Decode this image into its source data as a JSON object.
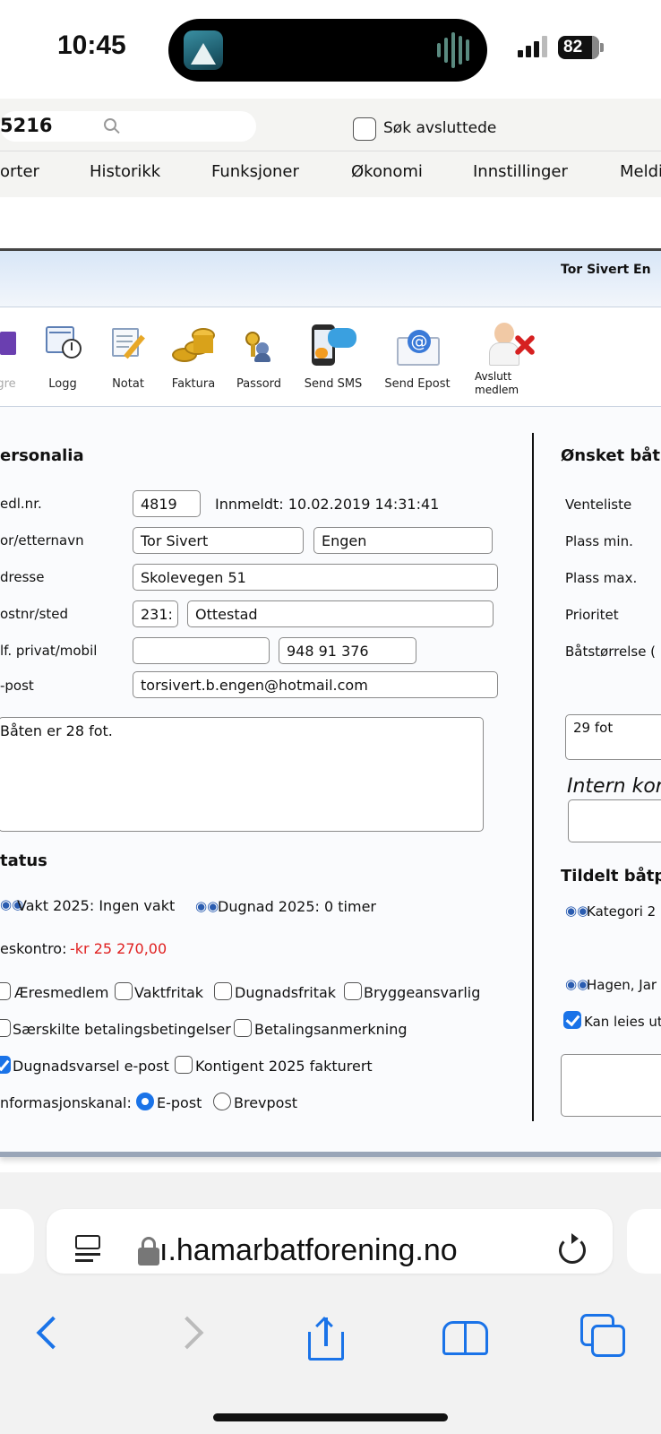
{
  "status_bar": {
    "time": "10:45",
    "battery": "82"
  },
  "browser": {
    "search_value": "5216",
    "show_closed_label": "Søk avsluttede",
    "menu": [
      "orter",
      "Historikk",
      "Funksjoner",
      "Økonomi",
      "Innstillinger",
      "Meldi"
    ],
    "url": "ı.hamarbatforening.no"
  },
  "panel": {
    "title": "Tor Sivert En",
    "toolbar": [
      {
        "label": "gre",
        "icon": "edit-icon"
      },
      {
        "label": "Logg",
        "icon": "calendar-clock-icon"
      },
      {
        "label": "Notat",
        "icon": "note-icon"
      },
      {
        "label": "Faktura",
        "icon": "coins-icon"
      },
      {
        "label": "Passord",
        "icon": "key-user-icon"
      },
      {
        "label": "Send SMS",
        "icon": "phone-sms-icon"
      },
      {
        "label": "Send Epost",
        "icon": "email-icon"
      },
      {
        "label": "Avslutt medlem",
        "icon": "remove-member-icon"
      }
    ],
    "personalia": {
      "heading": "ersonalia",
      "member_no_label": "edl.nr.",
      "member_no": "4819",
      "registered": "Innmeldt: 10.02.2019 14:31:41",
      "name_label": "or/etternavn",
      "first_name": "Tor Sivert",
      "last_name": "Engen",
      "address_label": "dresse",
      "address": "Skolevegen 51",
      "postal_label": "ostnr/sted",
      "postal_code": "231:",
      "city": "Ottestad",
      "phone_label": "lf. privat/mobil",
      "phone_private": "",
      "phone_mobile": "948 91 376",
      "email_label": "-post",
      "email": "torsivert.b.engen@hotmail.com",
      "comment": "Båten er 28 fot."
    },
    "status": {
      "heading": "tatus",
      "watch": "Vakt 2025: Ingen vakt",
      "dugnad": "Dugnad 2025: 0 timer",
      "account_label": "eskontro:",
      "account_value": "-kr 25 270,00",
      "account_color": "#e02020",
      "honorary": "Æresmedlem",
      "watch_exempt": "Vaktfritak",
      "dugnad_exempt": "Dugnadsfritak",
      "dock_responsible": "Bryggeansvarlig",
      "special_terms": "Særskilte betalingsbetingelser",
      "payment_note": "Betalingsanmerkning",
      "dugnad_email": "Dugnadsvarsel e-post",
      "contingent_invoiced": "Kontigent 2025 fakturert",
      "channel_label": "nformasjonskanal:",
      "channel_email": "E-post",
      "channel_letter": "Brevpost"
    },
    "wish": {
      "heading": "Ønsket båtp",
      "waitlist": "Venteliste",
      "min": "Plass min.",
      "max": "Plass max.",
      "priority": "Prioritet",
      "boat_size": "Båtstørrelse (",
      "size_value": "29 fot",
      "internal_comment": "Intern kor"
    },
    "assigned": {
      "heading": "Tildelt båtp",
      "category": "Kategori 2",
      "owner": "Hagen, Jar",
      "can_rent": "Kan leies ut"
    }
  }
}
